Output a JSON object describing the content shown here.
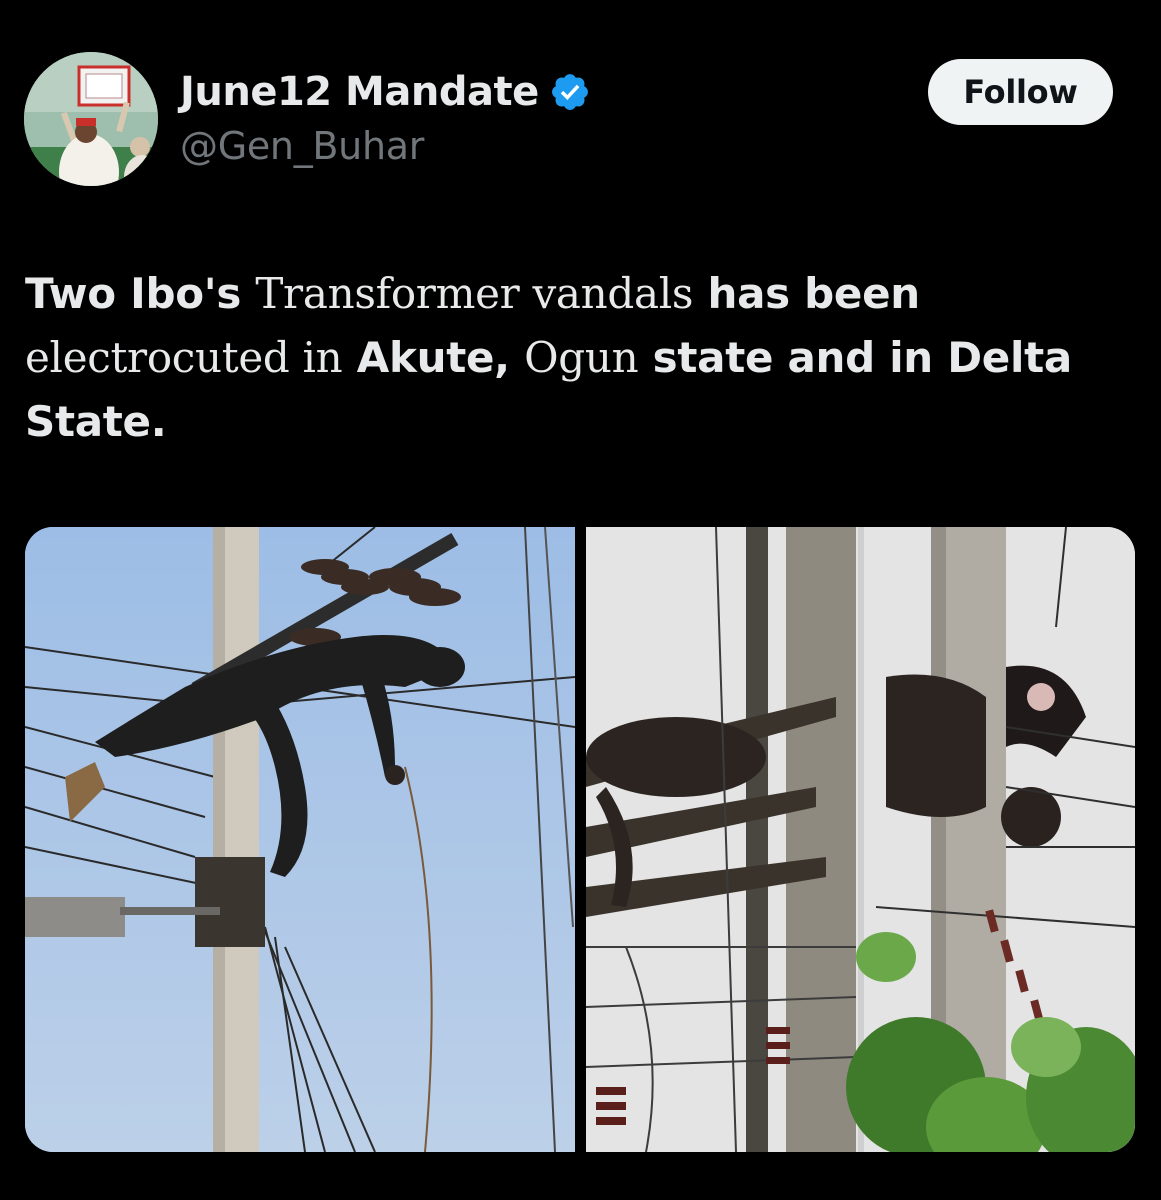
{
  "author": {
    "display_name": "June12 Mandate",
    "handle": "@Gen_Buhar",
    "verified": true,
    "verified_color": "#1d9bf0",
    "avatar": "profile-photo"
  },
  "actions": {
    "follow_label": "Follow"
  },
  "tweet": {
    "segments": [
      {
        "text": "Two Ibo's ",
        "style": "bold-sans"
      },
      {
        "text": "Transformer vandals",
        "style": "serif"
      },
      {
        "text": " has been ",
        "style": "bold-sans"
      },
      {
        "text": "electrocuted in",
        "style": "serif"
      },
      {
        "text": " Akute, ",
        "style": "bold-sans"
      },
      {
        "text": "Ogun",
        "style": "serif"
      },
      {
        "text": " state and in Delta State.",
        "style": "bold-sans"
      }
    ]
  },
  "media": {
    "images": [
      {
        "name": "electric-pole-photo-akute"
      },
      {
        "name": "electric-pole-photo-delta"
      }
    ]
  },
  "colors": {
    "background": "#000000",
    "text": "#e7e9ea",
    "secondary_text": "#71767b",
    "button_bg": "#eff3f4"
  }
}
